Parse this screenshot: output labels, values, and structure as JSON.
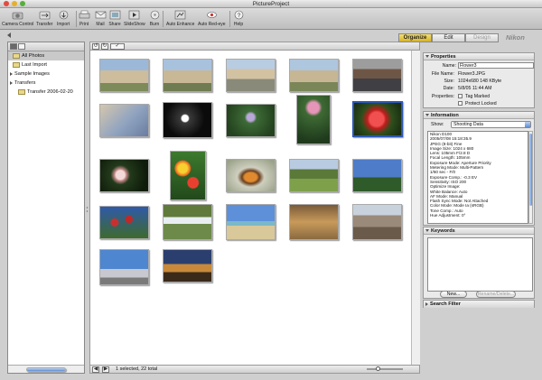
{
  "window": {
    "title": "PictureProject"
  },
  "toolbar": {
    "buttons": [
      {
        "label": "Camera Control"
      },
      {
        "label": "Transfer"
      },
      {
        "label": "Import"
      },
      {
        "label": "Print"
      },
      {
        "label": "Mail"
      },
      {
        "label": "Share"
      },
      {
        "label": "SlideShow"
      },
      {
        "label": "Burn"
      },
      {
        "label": "Auto Enhance"
      },
      {
        "label": "Auto Red-eye"
      },
      {
        "label": "Help"
      }
    ]
  },
  "sidebar": {
    "items": [
      {
        "label": "All Photos",
        "selected": true
      },
      {
        "label": "Last Import"
      },
      {
        "label": "Sample Images"
      },
      {
        "label": "Transfers"
      },
      {
        "label": "Transfer 2006-02-20"
      }
    ]
  },
  "modes": [
    {
      "label": "Organize",
      "active": true
    },
    {
      "label": "Edit"
    },
    {
      "label": "Design",
      "disabled": true
    }
  ],
  "brand": "Nikon",
  "browser": {
    "status": "1 selected, 22 total",
    "thumbnail_count": 22,
    "selected_index": 9
  },
  "properties": {
    "header": "Properties",
    "name_label": "Name:",
    "name_value": "Flower3",
    "filename_label": "File Name:",
    "filename_value": "Flower3.JPG",
    "size_label": "Size:",
    "size_value": "1024x680  148 KByte",
    "date_label": "Date:",
    "date_value": "5/8/05 11:44 AM",
    "properties_label": "Properties:",
    "tag_marked": "Tag Marked",
    "protect_locked": "Protect Locked"
  },
  "information": {
    "header": "Information",
    "show_label": "Show:",
    "show_value": "Shooting Data",
    "lines": [
      "Nikon D100",
      "2005/07/08 15:18:35.9",
      "JPEG (8-bit) Fine",
      "Image Size: 1024 x 680",
      "Lens: 105mm F/2.8 D",
      "Focal Length: 105mm",
      "Exposure Mode: Aperture Priority",
      "Metering Mode: Multi-Pattern",
      "1/60 sec - F/0",
      "Exposure Comp.: -0.3 EV",
      "Sensitivity: ISO 200",
      "Optimize Image:",
      "White Balance: Auto",
      "AF Mode: Manual",
      "Flash Sync Mode: Not Attached",
      "Color Mode: Mode Ia (sRGB)",
      "Tone Comp.: Auto",
      "Hue Adjustment: 0°"
    ]
  },
  "keywords": {
    "header": "Keywords",
    "new_label": "New...",
    "rename_label": "Rename/Delete..."
  },
  "search_filter": {
    "header": "Search Filter"
  }
}
